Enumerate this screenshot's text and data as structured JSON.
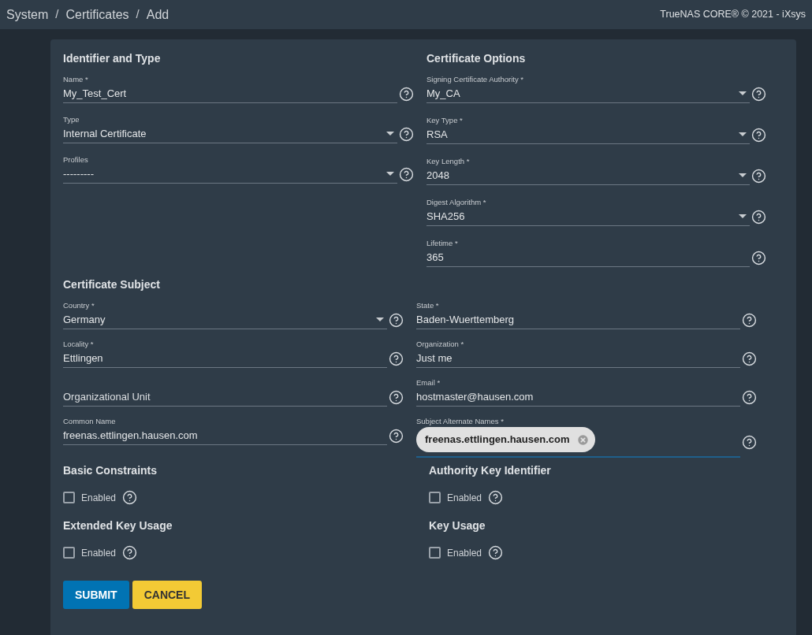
{
  "topbar": {
    "breadcrumb": [
      "System",
      "/",
      "Certificates",
      "/",
      "Add"
    ],
    "copyright": "TrueNAS CORE® © 2021 - iXsys"
  },
  "identifier": {
    "title": "Identifier and Type",
    "fields": [
      {
        "kind": "input",
        "label": "Name *",
        "value": "My_Test_Cert"
      },
      {
        "kind": "select",
        "label": "Type",
        "value": "Internal Certificate"
      },
      {
        "kind": "select",
        "label": "Profiles",
        "value": "---------"
      }
    ]
  },
  "options": {
    "title": "Certificate Options",
    "fields": [
      {
        "kind": "select",
        "label": "Signing Certificate Authority *",
        "value": "My_CA"
      },
      {
        "kind": "select",
        "label": "Key Type *",
        "value": "RSA"
      },
      {
        "kind": "select",
        "label": "Key Length *",
        "value": "2048"
      },
      {
        "kind": "select",
        "label": "Digest Algorithm *",
        "value": "SHA256"
      },
      {
        "kind": "input",
        "label": "Lifetime *",
        "value": "365"
      }
    ]
  },
  "subject": {
    "title": "Certificate Subject",
    "rows": [
      [
        {
          "kind": "select",
          "label": "Country *",
          "value": "Germany"
        },
        {
          "kind": "input",
          "label": "State *",
          "value": "Baden-Wuerttemberg"
        }
      ],
      [
        {
          "kind": "input",
          "label": "Locality *",
          "value": "Ettlingen"
        },
        {
          "kind": "input",
          "label": "Organization *",
          "value": "Just me"
        }
      ],
      [
        {
          "kind": "input",
          "placeholder": "Organizational Unit"
        },
        {
          "kind": "input",
          "label": "Email *",
          "value": "hostmaster@hausen.com"
        }
      ],
      [
        {
          "kind": "input",
          "label": "Common Name",
          "value": "freenas.ettlingen.hausen.com"
        },
        {
          "kind": "chips",
          "label": "Subject Alternate Names *",
          "focused": true,
          "chips": [
            "freenas.ettlingen.hausen.com"
          ]
        }
      ]
    ]
  },
  "extensions": [
    {
      "title": "Basic Constraints",
      "label": "Enabled",
      "checked": false
    },
    {
      "title": "Authority Key Identifier",
      "label": "Enabled",
      "checked": false
    },
    {
      "title": "Extended Key Usage",
      "label": "Enabled",
      "checked": false
    },
    {
      "title": "Key Usage",
      "label": "Enabled",
      "checked": false
    }
  ],
  "buttons": [
    {
      "label": "SUBMIT",
      "kind": "primary"
    },
    {
      "label": "CANCEL",
      "kind": "secondary"
    }
  ]
}
